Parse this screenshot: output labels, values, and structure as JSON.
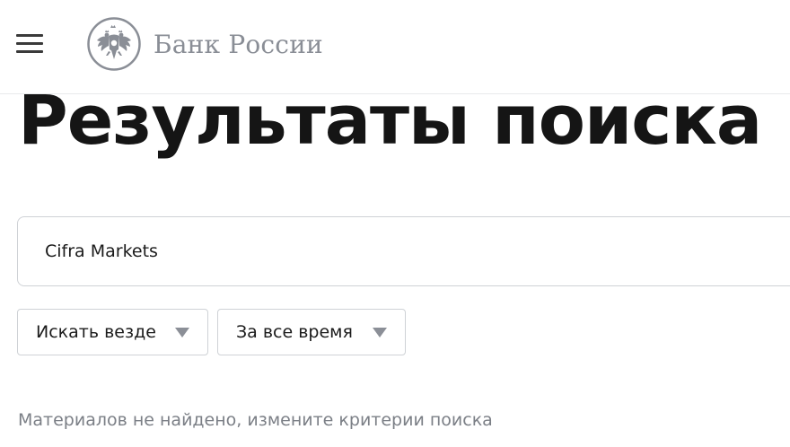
{
  "header": {
    "menu_icon": "hamburger-menu-icon",
    "logo_icon": "double-headed-eagle-emblem",
    "logo_text": "Банк России"
  },
  "main": {
    "title": "Результаты поиска",
    "search": {
      "value": "Cifra Markets",
      "placeholder": ""
    },
    "filters": {
      "scope_selected": "Искать везде",
      "period_selected": "За все время"
    },
    "empty_message": "Материалов не найдено, измените критерии поиска"
  },
  "colors": {
    "logo_gray": "#8a8e96",
    "text_dark": "#151515",
    "text_muted": "#7b7f86",
    "border": "#cfd2d6",
    "arrow": "#8b8f97"
  }
}
